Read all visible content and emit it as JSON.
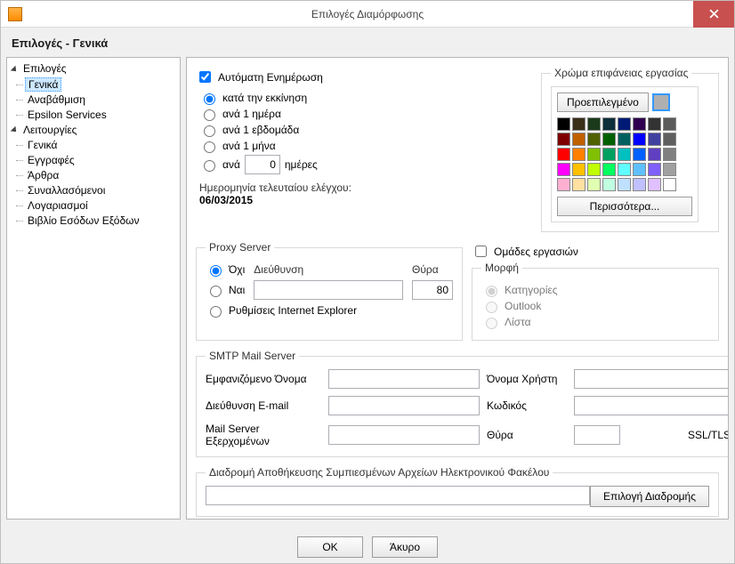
{
  "window": {
    "title": "Επιλογές Διαμόρφωσης"
  },
  "page": {
    "heading": "Επιλογές - Γενικά"
  },
  "tree": {
    "root1": "Επιλογές",
    "root1_items": {
      "a": "Γενικά",
      "b": "Αναβάθμιση",
      "c": "Epsilon Services"
    },
    "root2": "Λειτουργίες",
    "root2_items": {
      "a": "Γενικά",
      "b": "Εγγραφές",
      "c": "Άρθρα",
      "d": "Συναλλασόμενοι",
      "e": "Λογαριασμοί",
      "f": "Βιβλίο Εσόδων Εξόδων"
    }
  },
  "update": {
    "auto_label": "Αυτόματη Ενημέρωση",
    "r_startup": "κατά την εκκίνηση",
    "r_daily": "ανά 1 ημέρα",
    "r_weekly": "ανά 1 εβδομάδα",
    "r_monthly": "ανά 1 μήνα",
    "r_every_prefix": "ανά",
    "r_every_value": "0",
    "r_every_suffix": "ημέρες",
    "lastcheck_label": "Ημερομηνία τελευταίου ελέγχου:",
    "lastcheck_value": "06/03/2015"
  },
  "color": {
    "legend": "Χρώμα επιφάνειας εργασίας",
    "default_btn": "Προεπιλεγμένο",
    "more_btn": "Περισσότερα...",
    "swatches": [
      "#000000",
      "#3b2f1a",
      "#1b3a1b",
      "#0e2f3a",
      "#001b75",
      "#2f004f",
      "#333333",
      "#5b5b5b",
      "#7f0000",
      "#c06000",
      "#4f6000",
      "#006000",
      "#006060",
      "#0000ff",
      "#4040a0",
      "#606060",
      "#ff0000",
      "#ff8000",
      "#80c000",
      "#00a060",
      "#00c0c0",
      "#0060ff",
      "#6040c0",
      "#808080",
      "#ff00ff",
      "#ffc000",
      "#c0ff00",
      "#00ff60",
      "#60ffff",
      "#60c0ff",
      "#8060ff",
      "#a0a0a0",
      "#ffb0d0",
      "#ffe0a0",
      "#e0ffb0",
      "#c0ffe0",
      "#c0e0ff",
      "#c0c0ff",
      "#e0c0ff",
      "#ffffff"
    ]
  },
  "proxy": {
    "legend": "Proxy Server",
    "r_no": "Όχι",
    "r_yes": "Ναι",
    "r_ie": "Ρυθμίσεις Internet Explorer",
    "addr_label": "Διεύθυνση",
    "port_label": "Θύρα",
    "addr_value": "",
    "port_value": "80"
  },
  "groups": {
    "checkbox": "Ομάδες εργασιών",
    "legend": "Μορφή",
    "r_categories": "Κατηγορίες",
    "r_outlook": "Outlook",
    "r_list": "Λίστα"
  },
  "smtp": {
    "legend": "SMTP Mail Server",
    "display_name": "Εμφανιζόμενο Όνομα",
    "email": "Διεύθυνση E-mail",
    "outgoing": "Mail Server Εξερχομένων",
    "username": "Όνομα Χρήστη",
    "password": "Κωδικός",
    "port": "Θύρα",
    "ssl": "SSL/TLS",
    "display_name_value": "",
    "email_value": "",
    "outgoing_value": "",
    "username_value": "",
    "password_value": "",
    "port_value": ""
  },
  "path": {
    "legend": "Διαδρομή Αποθήκευσης Συμπιεσμένων Αρχείων Ηλεκτρονικού Φακέλου",
    "value": "",
    "browse": "Επιλογή Διαδρομής"
  },
  "buttons": {
    "ok": "OK",
    "cancel": "Άκυρο"
  }
}
